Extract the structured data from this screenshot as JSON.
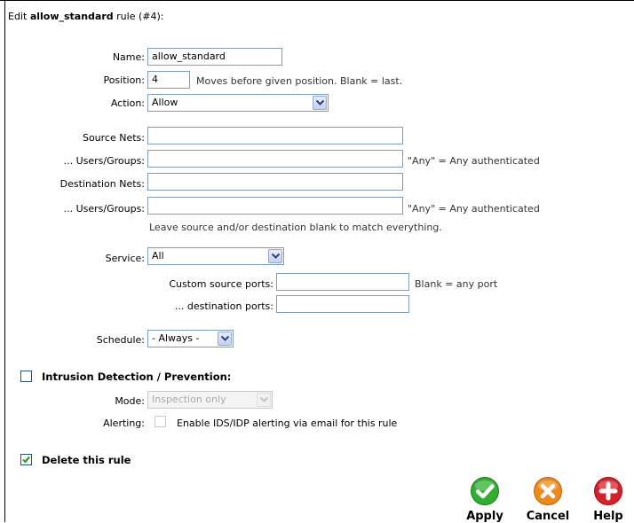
{
  "header": {
    "prefix": "Edit ",
    "rule_name": "allow_standard",
    "suffix": " rule (#4):"
  },
  "fields": {
    "name": {
      "label": "Name:",
      "value": "allow_standard"
    },
    "position": {
      "label": "Position:",
      "value": "4",
      "hint": "Moves before given position. Blank = last."
    },
    "action": {
      "label": "Action:",
      "selected": "Allow"
    },
    "source_nets": {
      "label": "Source Nets:",
      "value": ""
    },
    "source_users": {
      "label": "... Users/Groups:",
      "value": "",
      "hint": "\"Any\" = Any authenticated"
    },
    "dest_nets": {
      "label": "Destination Nets:",
      "value": ""
    },
    "dest_users": {
      "label": "... Users/Groups:",
      "value": "",
      "hint": "\"Any\" = Any authenticated"
    },
    "blank_note": "Leave source and/or destination blank to match everything.",
    "service": {
      "label": "Service:",
      "selected": "All"
    },
    "custom_source_ports": {
      "label": "Custom source ports:",
      "value": "",
      "hint": "Blank = any port"
    },
    "destination_ports": {
      "label": "... destination ports:",
      "value": ""
    },
    "schedule": {
      "label": "Schedule:",
      "selected": "- Always -"
    }
  },
  "ids": {
    "title": "Intrusion Detection / Prevention:",
    "checked": false,
    "mode_label": "Mode:",
    "mode_selected": "Inspection only",
    "alerting_label": "Alerting:",
    "alerting_text": "Enable IDS/IDP alerting via email for this rule",
    "alerting_checked": false
  },
  "delete": {
    "label": "Delete this rule",
    "checked": true
  },
  "buttons": {
    "apply": "Apply",
    "cancel": "Cancel",
    "help": "Help"
  },
  "colors": {
    "apply": "#2fae2f",
    "cancel": "#ee8a1c",
    "help": "#d6202a",
    "input_border": "#7f9db9"
  }
}
